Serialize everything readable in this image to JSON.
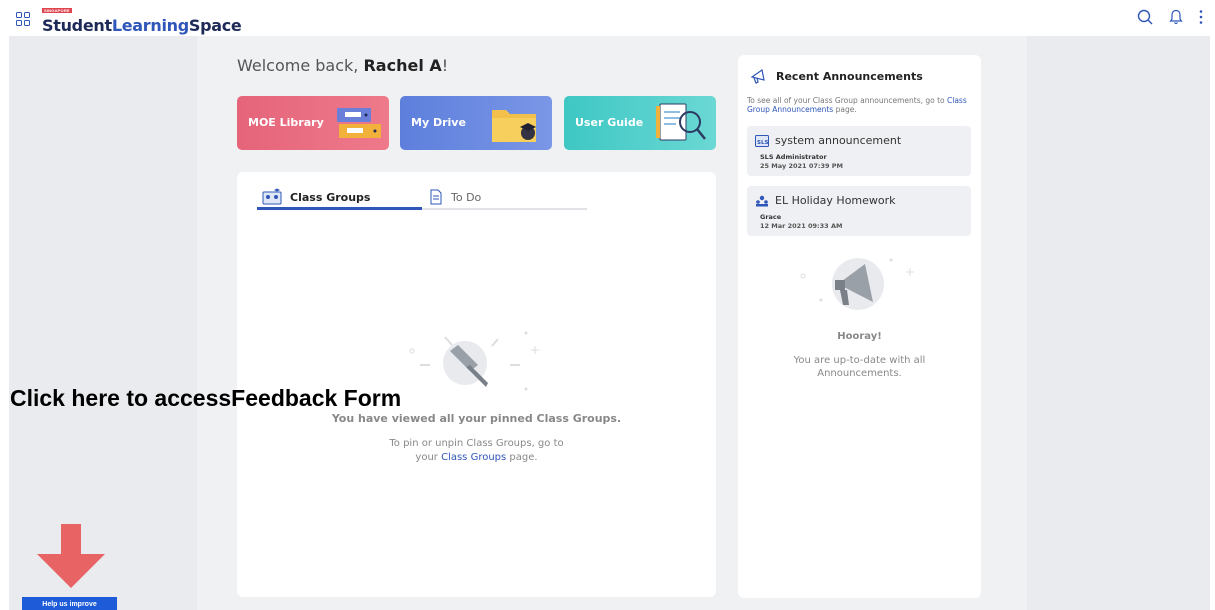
{
  "header": {
    "logo_tag": "SINGAPORE",
    "logo_part1": "Student",
    "logo_part2": "Learning",
    "logo_part3": "Space",
    "icons": [
      "apps-grid-icon",
      "search-icon",
      "bell-icon",
      "more-vertical-icon"
    ]
  },
  "welcome": {
    "prefix": "Welcome back, ",
    "name": "Rachel A",
    "suffix": "!"
  },
  "tiles": [
    {
      "label": "MOE Library",
      "color": "#e8687c"
    },
    {
      "label": "My Drive",
      "color": "#6786e0"
    },
    {
      "label": "User Guide",
      "color": "#4ccbc7"
    }
  ],
  "class_groups": {
    "tab_class_groups": "Class Groups",
    "tab_todo": "To Do",
    "empty_title": "You have viewed all your pinned Class Groups.",
    "empty_line1": "To pin or unpin Class Groups, go to",
    "empty_line2_prefix": "your ",
    "empty_link": "Class Groups",
    "empty_line2_suffix": " page."
  },
  "announcements": {
    "title": "Recent Announcements",
    "desc_prefix": "To see all of your Class Group announcements, go to ",
    "desc_link": "Class Group Announcements",
    "desc_suffix": " page.",
    "items": [
      {
        "title": "system announcement",
        "author": "SLS Administrator",
        "date": "25 May 2021 07:39 PM",
        "icon": "sls-icon"
      },
      {
        "title": "EL Holiday Homework",
        "author": "Grace",
        "date": "12 Mar 2021 09:33 AM",
        "icon": "group-icon"
      }
    ],
    "empty_title": "Hooray!",
    "empty_text": "You are up-to-date with all Announcements."
  },
  "overlay": {
    "text": "Click here to accessFeedback Form",
    "help_button": "Help us improve",
    "arrow_color": "#e86363",
    "button_color": "#1e5bd8"
  }
}
